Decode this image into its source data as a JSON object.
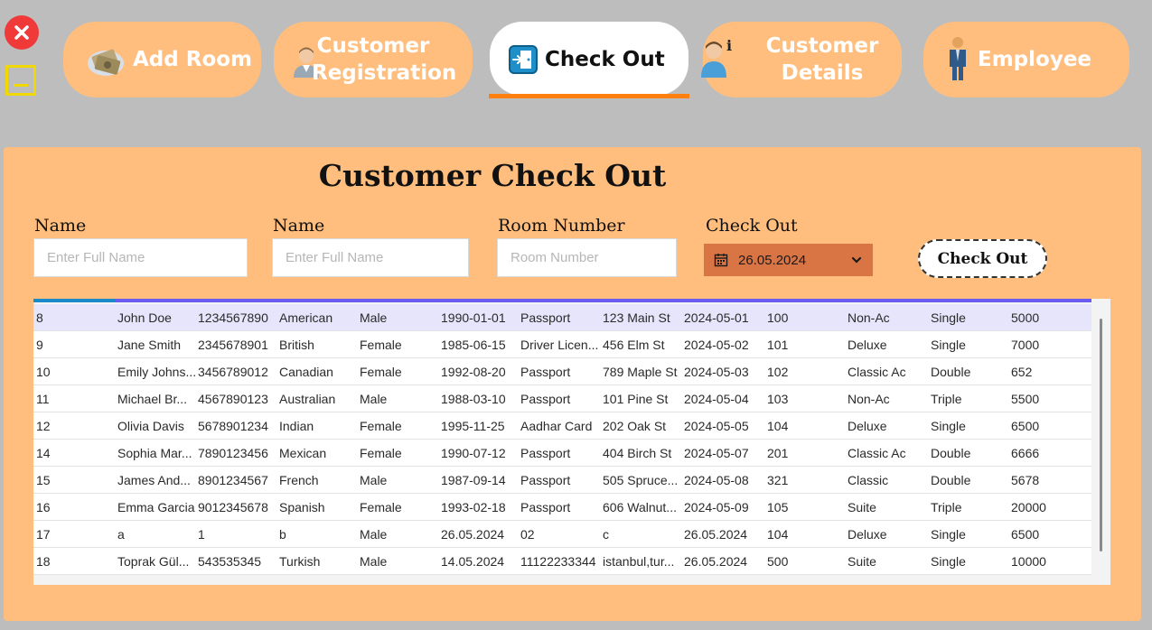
{
  "nav": {
    "tabs": [
      {
        "id": "add-room",
        "label_lines": [
          "Add Room"
        ],
        "icon": "money-icon",
        "active": false
      },
      {
        "id": "customer-registration",
        "label_lines": [
          "Customer",
          "Registration"
        ],
        "icon": "user-avatar-icon",
        "active": false
      },
      {
        "id": "check-out",
        "label_lines": [
          "Check Out"
        ],
        "icon": "exit-door-icon",
        "active": true
      },
      {
        "id": "customer-details",
        "label_lines": [
          "Customer",
          "Details"
        ],
        "icon": "user-info-icon",
        "active": false
      },
      {
        "id": "employee",
        "label_lines": [
          "Employee"
        ],
        "icon": "employee-icon",
        "active": false
      }
    ]
  },
  "page": {
    "title": "Customer Check Out"
  },
  "form": {
    "name1_label": "Name",
    "name1_placeholder": "Enter Full Name",
    "name2_label": "Name",
    "name2_placeholder": "Enter Full Name",
    "room_label": "Room Number",
    "room_placeholder": "Room Number",
    "checkout_label": "Check Out",
    "checkout_date": "26.05.2024",
    "checkout_button": "Check Out"
  },
  "colors": {
    "accent": "#ffbe7d",
    "date_picker": "#d97544",
    "underline": "#ff7f0e",
    "close": "#f03a3a",
    "minimize": "#f0d800"
  },
  "table": {
    "selected_index": 0,
    "rows": [
      [
        "8",
        "John Doe",
        "1234567890",
        "American",
        "Male",
        "1990-01-01",
        "Passport",
        "123 Main St",
        "2024-05-01",
        "100",
        "Non-Ac",
        "Single",
        "5000"
      ],
      [
        "9",
        "Jane Smith",
        "2345678901",
        "British",
        "Female",
        "1985-06-15",
        "Driver Licen...",
        "456 Elm St",
        "2024-05-02",
        "101",
        "Deluxe",
        "Single",
        "7000"
      ],
      [
        "10",
        "Emily Johns...",
        "3456789012",
        "Canadian",
        "Female",
        "1992-08-20",
        "Passport",
        "789 Maple St",
        "2024-05-03",
        "102",
        "Classic Ac",
        "Double",
        "652"
      ],
      [
        "11",
        "Michael Br...",
        "4567890123",
        "Australian",
        "Male",
        "1988-03-10",
        "Passport",
        "101 Pine St",
        "2024-05-04",
        "103",
        "Non-Ac",
        "Triple",
        "5500"
      ],
      [
        "12",
        "Olivia Davis",
        "5678901234",
        "Indian",
        "Female",
        "1995-11-25",
        "Aadhar Card",
        "202 Oak St",
        "2024-05-05",
        "104",
        "Deluxe",
        "Single",
        "6500"
      ],
      [
        "14",
        "Sophia Mar...",
        "7890123456",
        "Mexican",
        "Female",
        "1990-07-12",
        "Passport",
        "404 Birch St",
        "2024-05-07",
        "201",
        "Classic Ac",
        "Double",
        "6666"
      ],
      [
        "15",
        "James And...",
        "8901234567",
        "French",
        "Male",
        "1987-09-14",
        "Passport",
        "505 Spruce...",
        "2024-05-08",
        "321",
        "Classic",
        "Double",
        "5678"
      ],
      [
        "16",
        "Emma Garcia",
        "9012345678",
        "Spanish",
        "Female",
        "1993-02-18",
        "Passport",
        "606 Walnut...",
        "2024-05-09",
        "105",
        "Suite",
        "Triple",
        "20000"
      ],
      [
        "17",
        "a",
        "1",
        "b",
        "Male",
        "26.05.2024",
        "02",
        "c",
        "26.05.2024",
        "104",
        "Deluxe",
        "Single",
        "6500"
      ],
      [
        "18",
        "Toprak Gül...",
        "543535345",
        "Turkish",
        "Male",
        "14.05.2024",
        "11122233344",
        "istanbul,tur...",
        "26.05.2024",
        "500",
        "Suite",
        "Single",
        "10000"
      ]
    ]
  }
}
